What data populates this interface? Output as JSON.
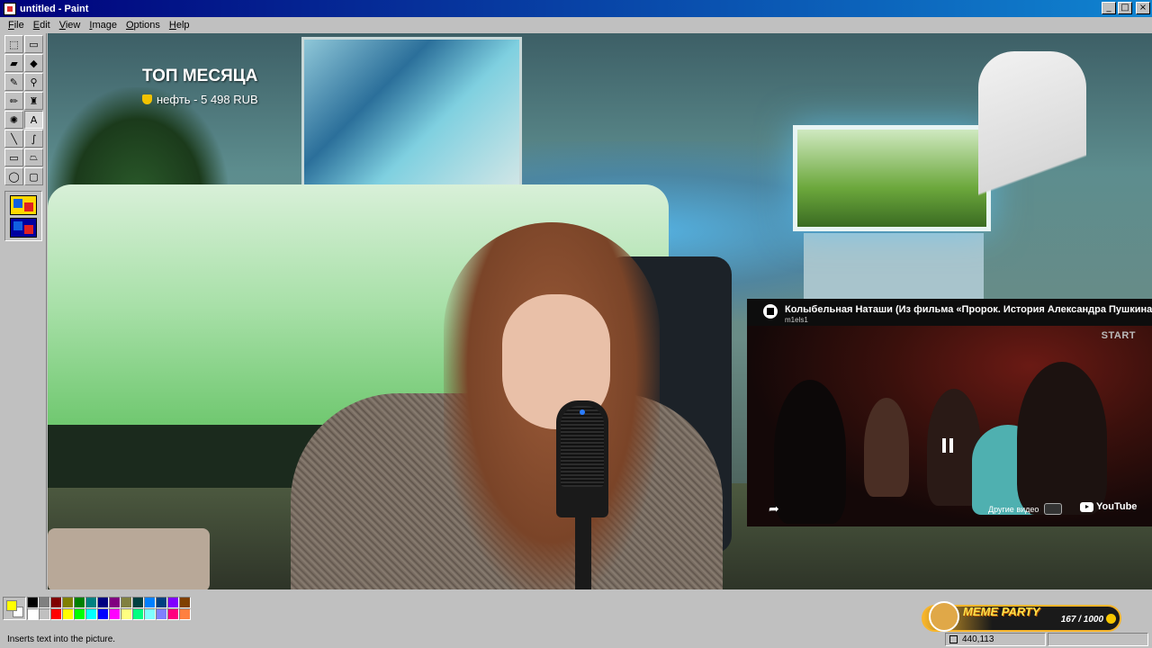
{
  "window": {
    "title": "untitled - Paint"
  },
  "menu": [
    {
      "underline": "F",
      "rest": "ile"
    },
    {
      "underline": "E",
      "rest": "dit"
    },
    {
      "underline": "V",
      "rest": "iew"
    },
    {
      "underline": "I",
      "rest": "mage"
    },
    {
      "underline": "O",
      "rest": "ptions"
    },
    {
      "underline": "H",
      "rest": "elp"
    }
  ],
  "tools": [
    {
      "name": "free-select-tool",
      "glyph": "⬚"
    },
    {
      "name": "select-tool",
      "glyph": "▭"
    },
    {
      "name": "eraser-tool",
      "glyph": "▰"
    },
    {
      "name": "fill-tool",
      "glyph": "◆"
    },
    {
      "name": "color-picker-tool",
      "glyph": "✎"
    },
    {
      "name": "magnifier-tool",
      "glyph": "⚲"
    },
    {
      "name": "pencil-tool",
      "glyph": "✏"
    },
    {
      "name": "brush-tool",
      "glyph": "♜"
    },
    {
      "name": "airbrush-tool",
      "glyph": "✺"
    },
    {
      "name": "text-tool",
      "glyph": "A",
      "pressed": true
    },
    {
      "name": "line-tool",
      "glyph": "╲"
    },
    {
      "name": "curve-tool",
      "glyph": "∫"
    },
    {
      "name": "rectangle-tool",
      "glyph": "▭"
    },
    {
      "name": "polygon-tool",
      "glyph": "⏢"
    },
    {
      "name": "ellipse-tool",
      "glyph": "◯"
    },
    {
      "name": "rounded-rect-tool",
      "glyph": "▢"
    }
  ],
  "overlay": {
    "top_month_title": "ТОП МЕСЯЦА",
    "top_donor": "нефть - 5 498 RUB"
  },
  "video": {
    "title": "Колыбельная Наташи (Из фильма «Пророк. История Александра Пушкина»)",
    "channel": "m1els1",
    "watermark": "START",
    "more_videos": "Другие видео",
    "youtube_label": "YouTube"
  },
  "palette": {
    "foreground": "#ffff00",
    "background": "#ffffff",
    "colors": [
      "#000000",
      "#808080",
      "#800000",
      "#808000",
      "#008000",
      "#008080",
      "#000080",
      "#800080",
      "#808040",
      "#004040",
      "#0080ff",
      "#004080",
      "#8000ff",
      "#804000",
      "#ffffff",
      "#c0c0c0",
      "#ff0000",
      "#ffff00",
      "#00ff00",
      "#00ffff",
      "#0000ff",
      "#ff00ff",
      "#ffff80",
      "#00ff80",
      "#80ffff",
      "#8080ff",
      "#ff0080",
      "#ff8040"
    ]
  },
  "status": {
    "text": "Inserts text into the picture.",
    "coords": "440,113",
    "size": ""
  },
  "meme_party": {
    "title": "MEME PARTY",
    "count": "167 / 1000"
  }
}
